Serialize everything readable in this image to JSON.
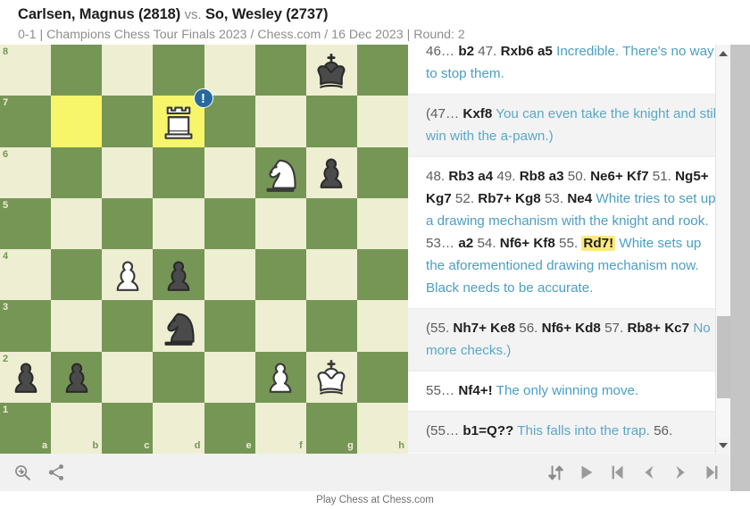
{
  "header": {
    "white_player": "Carlsen, Magnus (2818)",
    "vs": "vs.",
    "black_player": "So, Wesley (2737)",
    "subtitle": "0-1 | Champions Chess Tour Finals 2023 / Chess.com / 16 Dec 2023 | Round: 2"
  },
  "board": {
    "orientation": "white",
    "light_square_color": "#eeeed2",
    "dark_square_color": "#769656",
    "highlight_color": "#f7f569",
    "files": [
      "a",
      "b",
      "c",
      "d",
      "e",
      "f",
      "g",
      "h"
    ],
    "ranks": [
      "8",
      "7",
      "6",
      "5",
      "4",
      "3",
      "2",
      "1"
    ],
    "highlighted_squares": [
      "b7",
      "d7"
    ],
    "pieces": [
      {
        "square": "g8",
        "color": "black",
        "type": "king"
      },
      {
        "square": "d7",
        "color": "white",
        "type": "rook"
      },
      {
        "square": "f6",
        "color": "white",
        "type": "knight"
      },
      {
        "square": "g6",
        "color": "black",
        "type": "pawn"
      },
      {
        "square": "c4",
        "color": "white",
        "type": "pawn"
      },
      {
        "square": "d4",
        "color": "black",
        "type": "pawn"
      },
      {
        "square": "d3",
        "color": "black",
        "type": "knight"
      },
      {
        "square": "a2",
        "color": "black",
        "type": "pawn"
      },
      {
        "square": "b2",
        "color": "black",
        "type": "pawn"
      },
      {
        "square": "f2",
        "color": "white",
        "type": "pawn"
      },
      {
        "square": "g2",
        "color": "white",
        "type": "king"
      }
    ],
    "annotation_badge": {
      "square": "d7",
      "glyph": "!",
      "color": "#27699e",
      "meaning": "good-move"
    }
  },
  "movelist": {
    "rows": [
      {
        "kind": "main",
        "segments": [
          {
            "t": "num",
            "text": "46… "
          },
          {
            "t": "mv",
            "text": "b2"
          },
          {
            "t": "num",
            "text": " 47. "
          },
          {
            "t": "mv",
            "text": "Rxb6 a5"
          },
          {
            "t": "cmt",
            "text": " Incredible. There's no way to stop them."
          }
        ]
      },
      {
        "kind": "var",
        "segments": [
          {
            "t": "num",
            "text": "(47… "
          },
          {
            "t": "mv",
            "text": "Kxf8"
          },
          {
            "t": "cmt",
            "text": " You can even take the knight and still win with the a-pawn.)"
          }
        ]
      },
      {
        "kind": "main",
        "segments": [
          {
            "t": "num",
            "text": "48. "
          },
          {
            "t": "mv",
            "text": "Rb3 a4"
          },
          {
            "t": "num",
            "text": " 49. "
          },
          {
            "t": "mv",
            "text": "Rb8 a3"
          },
          {
            "t": "num",
            "text": " 50. "
          },
          {
            "t": "mv",
            "text": "Ne6+ Kf7"
          },
          {
            "t": "num",
            "text": " 51. "
          },
          {
            "t": "mv",
            "text": "Ng5+ Kg7"
          },
          {
            "t": "num",
            "text": " 52. "
          },
          {
            "t": "mv",
            "text": "Rb7+ Kg8"
          },
          {
            "t": "num",
            "text": " 53. "
          },
          {
            "t": "mv",
            "text": "Ne4"
          },
          {
            "t": "cmt",
            "text": " White tries to set up a drawing mechanism with the knight and rook. "
          },
          {
            "t": "num",
            "text": "53… "
          },
          {
            "t": "mv",
            "text": "a2"
          },
          {
            "t": "num",
            "text": " 54. "
          },
          {
            "t": "mv",
            "text": "Nf6+ Kf8"
          },
          {
            "t": "num",
            "text": " 55. "
          },
          {
            "t": "mvcur",
            "text": "Rd7!"
          },
          {
            "t": "cmt",
            "text": " White sets up the aforementioned drawing mechanism now. Black needs to be accurate."
          }
        ]
      },
      {
        "kind": "var",
        "segments": [
          {
            "t": "num",
            "text": "(55. "
          },
          {
            "t": "mv",
            "text": "Nh7+ Ke8"
          },
          {
            "t": "num",
            "text": " 56. "
          },
          {
            "t": "mv",
            "text": "Nf6+ Kd8"
          },
          {
            "t": "num",
            "text": " 57. "
          },
          {
            "t": "mv",
            "text": "Rb8+ Kc7"
          },
          {
            "t": "cmt",
            "text": " No more checks.)"
          }
        ]
      },
      {
        "kind": "main",
        "segments": [
          {
            "t": "num",
            "text": "55… "
          },
          {
            "t": "mv",
            "text": "Nf4+!"
          },
          {
            "t": "cmt",
            "text": " The only winning move."
          }
        ]
      },
      {
        "kind": "var",
        "segments": [
          {
            "t": "num",
            "text": "(55… "
          },
          {
            "t": "mv",
            "text": "b1=Q??"
          },
          {
            "t": "cmt",
            "text": " This falls into the trap. "
          },
          {
            "t": "num",
            "text": "56."
          }
        ]
      }
    ]
  },
  "scrollbar": {
    "up_arrow": "▲",
    "down_arrow": "▼"
  },
  "toolbar": {
    "left": [
      {
        "name": "analysis-zoom-icon",
        "label": "Analysis"
      },
      {
        "name": "share-icon",
        "label": "Share"
      }
    ],
    "right": [
      {
        "name": "flip-board-icon",
        "label": "Flip board"
      },
      {
        "name": "play-icon",
        "label": "Play"
      },
      {
        "name": "first-move-icon",
        "label": "First move"
      },
      {
        "name": "previous-move-icon",
        "label": "Previous move"
      },
      {
        "name": "next-move-icon",
        "label": "Next move"
      },
      {
        "name": "last-move-icon",
        "label": "Last move"
      }
    ]
  },
  "footer": {
    "text": "Play Chess at Chess.com"
  }
}
